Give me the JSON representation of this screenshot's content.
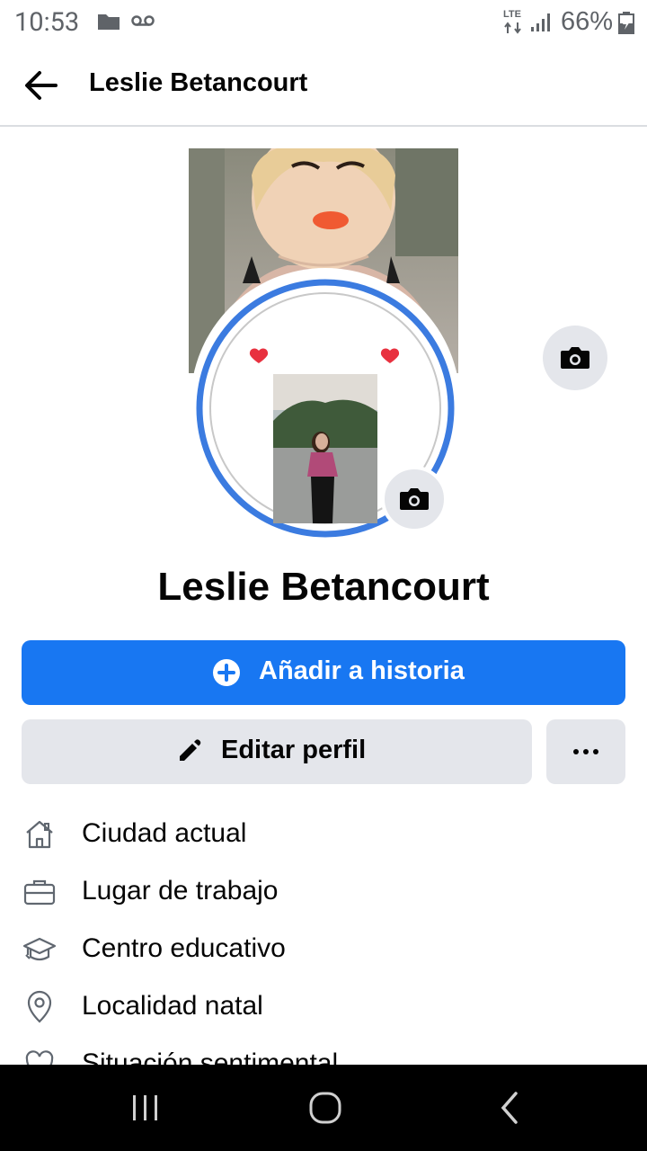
{
  "status_bar": {
    "time": "10:53",
    "network": "LTE",
    "battery": "66%",
    "icons": [
      "folder-icon",
      "voicemail-icon",
      "lte-icon",
      "signal-icon",
      "battery-icon"
    ]
  },
  "header": {
    "title": "Leslie Betancourt"
  },
  "profile": {
    "name": "Leslie Betancourt"
  },
  "actions": {
    "add_story_label": "Añadir a historia",
    "edit_profile_label": "Editar perfil"
  },
  "info_items": [
    {
      "label": "Ciudad actual",
      "icon": "home-icon"
    },
    {
      "label": "Lugar de trabajo",
      "icon": "briefcase-icon"
    },
    {
      "label": "Centro educativo",
      "icon": "graduation-cap-icon"
    },
    {
      "label": "Localidad natal",
      "icon": "location-pin-icon"
    },
    {
      "label": "Situación sentimental",
      "icon": "heart-icon"
    }
  ],
  "colors": {
    "brand_blue": "#1877f2",
    "button_gray": "#e4e6eb",
    "text": "#050505"
  }
}
